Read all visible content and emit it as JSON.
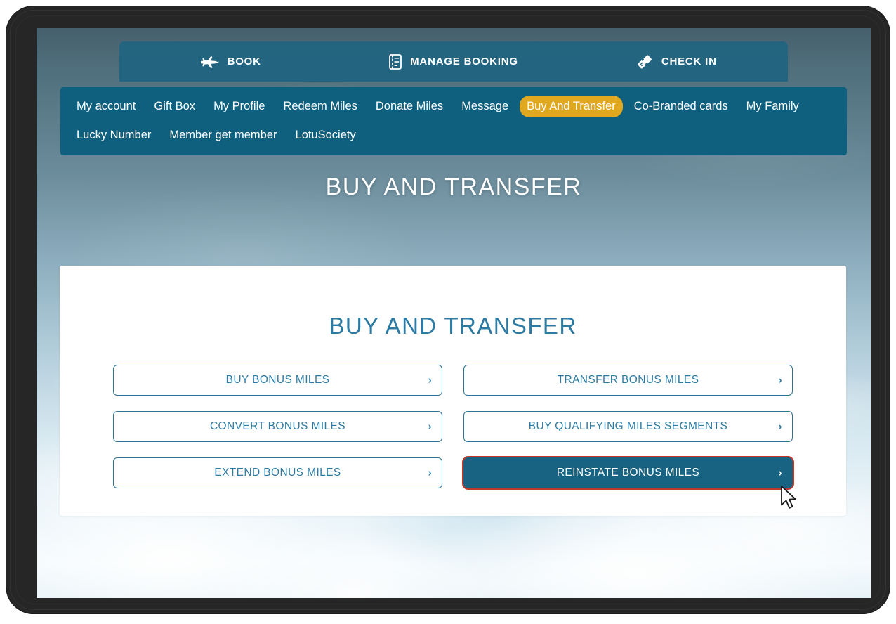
{
  "topbar": {
    "items": [
      {
        "label": "BOOK",
        "icon": "airplane-icon"
      },
      {
        "label": "MANAGE BOOKING",
        "icon": "booklet-icon"
      },
      {
        "label": "CHECK IN",
        "icon": "boarding-pass-icon"
      }
    ]
  },
  "subnav": {
    "items": [
      {
        "label": "My account",
        "active": false
      },
      {
        "label": "Gift Box",
        "active": false
      },
      {
        "label": "My Profile",
        "active": false
      },
      {
        "label": "Redeem Miles",
        "active": false
      },
      {
        "label": "Donate Miles",
        "active": false
      },
      {
        "label": "Message",
        "active": false
      },
      {
        "label": "Buy And Transfer",
        "active": true
      },
      {
        "label": "Co-Branded cards",
        "active": false
      },
      {
        "label": "My Family",
        "active": false
      },
      {
        "label": "Lucky Number",
        "active": false
      },
      {
        "label": "Member get member",
        "active": false
      },
      {
        "label": "LotuSociety",
        "active": false
      }
    ]
  },
  "hero": {
    "title": "BUY AND TRANSFER"
  },
  "card": {
    "title": "BUY AND TRANSFER",
    "chevron": "›",
    "options": [
      {
        "label": "BUY BONUS MILES",
        "selected": false,
        "highlight": false
      },
      {
        "label": "TRANSFER BONUS MILES",
        "selected": false,
        "highlight": false
      },
      {
        "label": "CONVERT BONUS MILES",
        "selected": false,
        "highlight": false
      },
      {
        "label": "BUY QUALIFYING MILES SEGMENTS",
        "selected": false,
        "highlight": false
      },
      {
        "label": "EXTEND BONUS MILES",
        "selected": false,
        "highlight": false
      },
      {
        "label": "REINSTATE BONUS MILES",
        "selected": true,
        "highlight": true
      }
    ]
  },
  "colors": {
    "brand_teal": "#0f607f",
    "topbar_teal": "#206480",
    "accent_gold": "#e0a81e",
    "link_blue": "#2c7ba4",
    "selected_fill": "#186381",
    "highlight_red": "#c0392b",
    "card_white": "#ffffff"
  }
}
